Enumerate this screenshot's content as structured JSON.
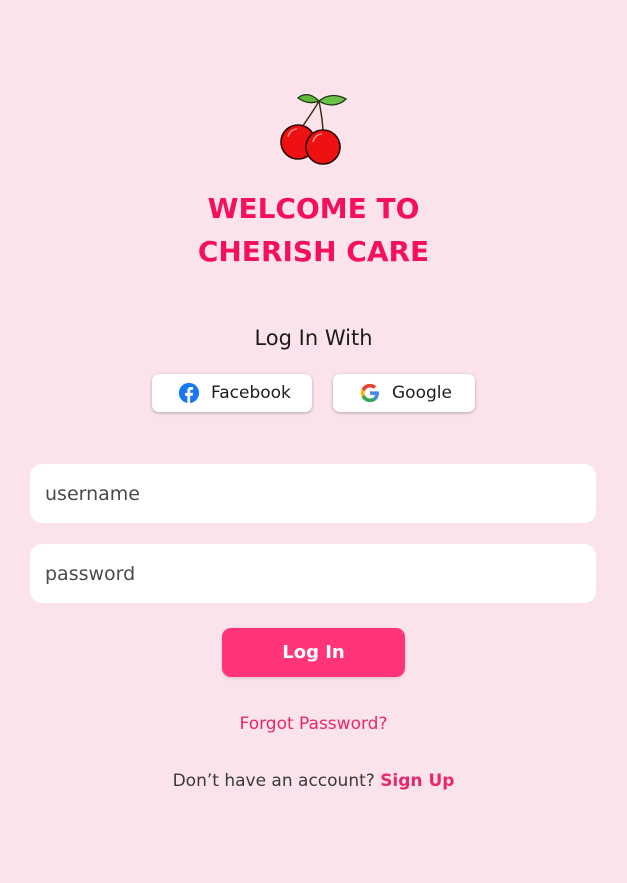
{
  "app": {
    "title_line1": "WELCOME TO",
    "title_line2": "CHERISH CARE",
    "logo_icon": "cherry-icon"
  },
  "social_login": {
    "heading": "Log In With",
    "facebook_label": "Facebook",
    "google_label": "Google"
  },
  "form": {
    "username_placeholder": "username",
    "username_value": "",
    "password_placeholder": "password",
    "password_value": "",
    "login_label": "Log In"
  },
  "links": {
    "forgot_password": "Forgot Password?",
    "no_account": "Don’t have an account?",
    "sign_up": "Sign Up"
  },
  "colors": {
    "background": "#fae3ea",
    "title": "#f5105e",
    "button": "#ff3479",
    "link": "#e8286d"
  }
}
